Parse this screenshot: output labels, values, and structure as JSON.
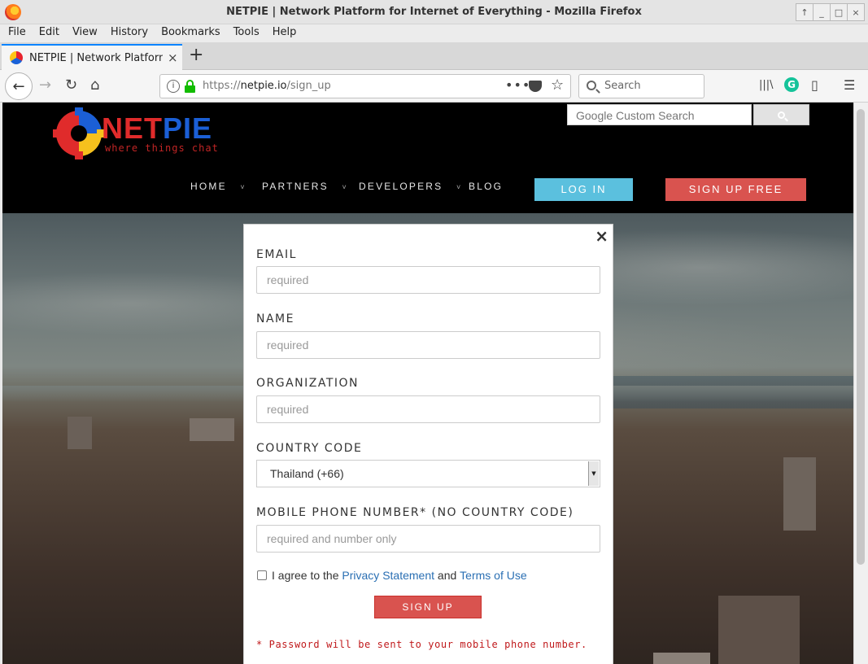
{
  "window": {
    "title": "NETPIE | Network Platform for Internet of Everything - Mozilla Firefox",
    "buttons": [
      "↑",
      "_",
      "□",
      "×"
    ]
  },
  "menu": [
    "File",
    "Edit",
    "View",
    "History",
    "Bookmarks",
    "Tools",
    "Help"
  ],
  "tab": {
    "title": "NETPIE | Network Platform fo",
    "close": "×",
    "new_tab": "+"
  },
  "navbar": {
    "back": "←",
    "forward": "→",
    "reload": "↻",
    "home": "⌂",
    "url_prefix": "https://",
    "url_host": "netpie.io",
    "url_path": "/sign_up",
    "page_actions": "•••",
    "bookmark_star": "☆",
    "search_placeholder": "Search",
    "library": "|||\\",
    "grammarly": "G",
    "sidebar": "▯",
    "hamburger": "☰"
  },
  "site": {
    "logo_net": "NET",
    "logo_pie": "PIE",
    "tagline": "where things chat",
    "google_search_placeholder": "Google Custom Search",
    "nav": [
      {
        "label": "HOME",
        "caret": "˅"
      },
      {
        "label": "PARTNERS",
        "caret": "˅"
      },
      {
        "label": "DEVELOPERS",
        "caret": "˅"
      },
      {
        "label": "BLOG",
        "caret": ""
      }
    ],
    "login": "LOG IN",
    "signup_free": "SIGN UP FREE"
  },
  "form": {
    "close": "×",
    "email_label": "EMAIL",
    "email_placeholder": "required",
    "name_label": "NAME",
    "name_placeholder": "required",
    "org_label": "ORGANIZATION",
    "org_placeholder": "required",
    "country_label": "COUNTRY CODE",
    "country_value": "Thailand (+66)",
    "phone_label": "MOBILE PHONE NUMBER* (NO COUNTRY CODE)",
    "phone_placeholder": "required and number only",
    "agree_prefix": "I agree to the",
    "privacy_link": "Privacy Statement",
    "agree_and": "and",
    "terms_link": "Terms of Use",
    "submit": "SIGN UP",
    "note": "* Password will be sent to your mobile phone number."
  },
  "colors": {
    "login": "#5bc0de",
    "signup": "#d9534f",
    "link": "#2a6fb3",
    "note": "#c0191b"
  }
}
